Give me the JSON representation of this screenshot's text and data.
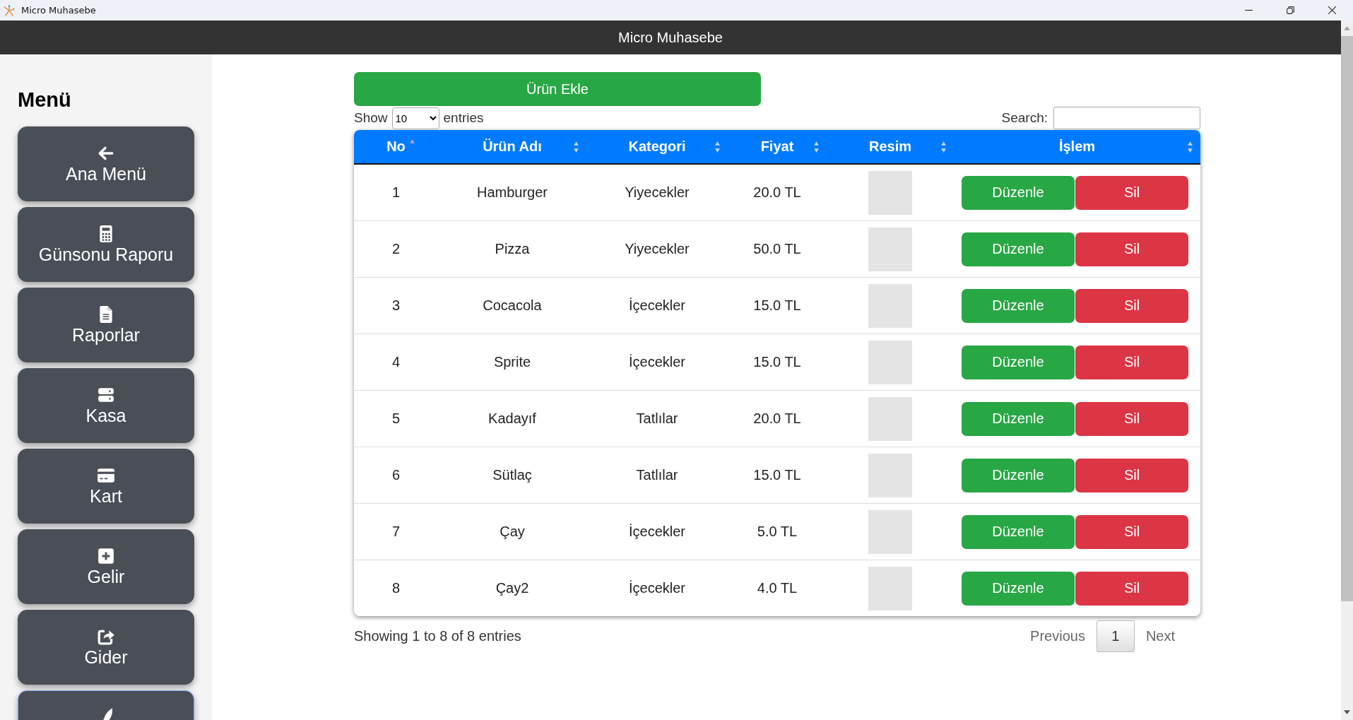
{
  "window": {
    "title": "Micro Muhasebe"
  },
  "header": {
    "title": "Micro Muhasebe"
  },
  "sidebar": {
    "title": "Menü",
    "items": [
      {
        "label": "Ana Menü",
        "focused": false
      },
      {
        "label": "Günsonu Raporu",
        "focused": false
      },
      {
        "label": "Raporlar",
        "focused": false
      },
      {
        "label": "Kasa",
        "focused": false
      },
      {
        "label": "Kart",
        "focused": false
      },
      {
        "label": "Gelir",
        "focused": false
      },
      {
        "label": "Gider",
        "focused": false
      },
      {
        "focused": true
      }
    ]
  },
  "add_button": {
    "label": "Ürün Ekle"
  },
  "length_control": {
    "before": "Show",
    "value": "10",
    "after": "entries"
  },
  "search": {
    "label": "Search:"
  },
  "table": {
    "columns": [
      {
        "label": "No",
        "sorted": true
      },
      {
        "label": "Ürün Adı",
        "sorted": false
      },
      {
        "label": "Kategori",
        "sorted": false
      },
      {
        "label": "Fiyat",
        "sorted": false
      },
      {
        "label": "Resim",
        "sorted": false
      },
      {
        "label": "İşlem",
        "sorted": false
      }
    ],
    "rows": [
      {
        "no": "1",
        "name": "Hamburger",
        "category": "Yiyecekler",
        "price": "20.0 TL",
        "edit": "Düzenle",
        "delete": "Sil"
      },
      {
        "no": "2",
        "name": "Pizza",
        "category": "Yiyecekler",
        "price": "50.0 TL",
        "edit": "Düzenle",
        "delete": "Sil"
      },
      {
        "no": "3",
        "name": "Cocacola",
        "category": "İçecekler",
        "price": "15.0 TL",
        "edit": "Düzenle",
        "delete": "Sil"
      },
      {
        "no": "4",
        "name": "Sprite",
        "category": "İçecekler",
        "price": "15.0 TL",
        "edit": "Düzenle",
        "delete": "Sil"
      },
      {
        "no": "5",
        "name": "Kadayıf",
        "category": "Tatlılar",
        "price": "20.0 TL",
        "edit": "Düzenle",
        "delete": "Sil"
      },
      {
        "no": "6",
        "name": "Sütlaç",
        "category": "Tatlılar",
        "price": "15.0 TL",
        "edit": "Düzenle",
        "delete": "Sil"
      },
      {
        "no": "7",
        "name": "Çay",
        "category": "İçecekler",
        "price": "5.0 TL",
        "edit": "Düzenle",
        "delete": "Sil"
      },
      {
        "no": "8",
        "name": "Çay2",
        "category": "İçecekler",
        "price": "4.0 TL",
        "edit": "Düzenle",
        "delete": "Sil"
      }
    ]
  },
  "info": "Showing 1 to 8 of 8 entries",
  "pagination": {
    "previous": "Previous",
    "pages": [
      {
        "label": "1",
        "selected": true
      }
    ],
    "next": "Next"
  }
}
